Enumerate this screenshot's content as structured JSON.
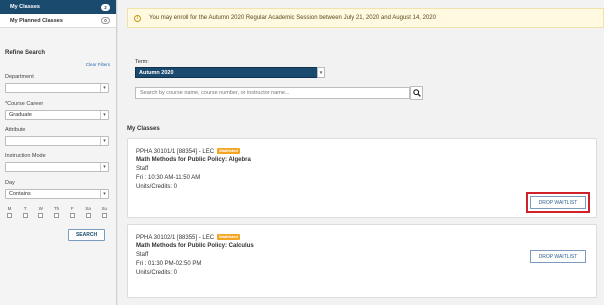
{
  "sidebar": {
    "nav": [
      {
        "label": "My Classes",
        "count": "2"
      },
      {
        "label": "My Planned Classes",
        "count": "0"
      }
    ],
    "refine_title": "Refine Search",
    "clear_filters": "Clear Filters",
    "department": {
      "label": "Department",
      "value": ""
    },
    "course_career": {
      "label": "*Course Career",
      "value": "Graduate"
    },
    "attribute": {
      "label": "Attribute",
      "value": ""
    },
    "instruction_mode": {
      "label": "Instruction Mode",
      "value": ""
    },
    "day": {
      "label": "Day",
      "value": "Contains"
    },
    "days": [
      "M",
      "T",
      "W",
      "Th",
      "F",
      "Sa",
      "Su"
    ],
    "search_button": "SEARCH"
  },
  "main": {
    "alert": "You may enroll for the Autumn 2020 Regular Academic Session between July 21, 2020 and August 14, 2020",
    "term_label": "Term:",
    "term_value": "Autumn 2020",
    "search_placeholder": "Search by course name, course number, or instructor name...",
    "section_title": "My Classes",
    "classes": [
      {
        "code": "PPHA 30101/1 [88354] - LEC",
        "status": "Waitlisted",
        "title": "Math Methods for Public Policy: Algebra",
        "instructor": "Staff",
        "schedule": "Fri : 10:30 AM-11:50 AM",
        "units": "Units/Credits:  0",
        "action": "DROP WAITLIST"
      },
      {
        "code": "PPHA 30102/1 [88355] - LEC",
        "status": "Waitlisted",
        "title": "Math Methods for Public Policy: Calculus",
        "instructor": "Staff",
        "schedule": "Fri : 01:30 PM-02:50 PM",
        "units": "Units/Credits:  0",
        "action": "DROP WAITLIST"
      }
    ]
  },
  "colors": {
    "nav_active": "#1a4a6e",
    "waitlisted_badge": "#f5a524",
    "highlight_border": "#d0202a",
    "alert_bg": "#fff9e2"
  },
  "icons": {
    "alert": "info-circle-icon",
    "search": "magnifier-icon",
    "dropdown": "chevron-down-icon"
  }
}
